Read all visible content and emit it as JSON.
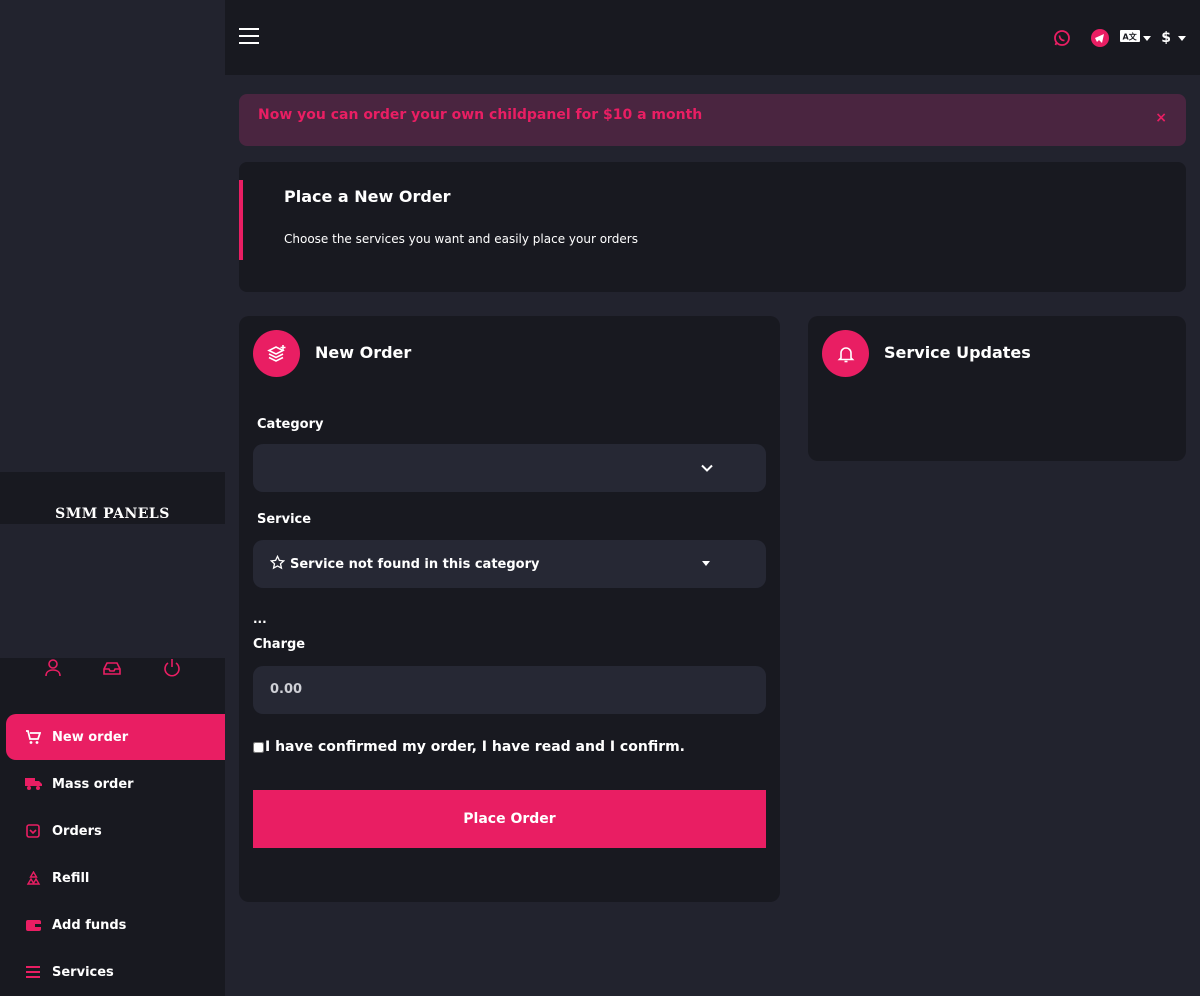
{
  "brand": {
    "logo_text": "SMM PANELS",
    "accent": "#e91e63"
  },
  "sidebar": {
    "user_icons": [
      "user-icon",
      "inbox-icon",
      "power-icon"
    ],
    "items": [
      {
        "label": "New order",
        "icon": "cart-plus-icon",
        "active": true
      },
      {
        "label": "Mass order",
        "icon": "truck-icon",
        "active": false
      },
      {
        "label": "Orders",
        "icon": "box-icon",
        "active": false
      },
      {
        "label": "Refill",
        "icon": "recycle-icon",
        "active": false
      },
      {
        "label": "Add funds",
        "icon": "wallet-icon",
        "active": false
      },
      {
        "label": "Services",
        "icon": "list-icon",
        "active": false
      }
    ]
  },
  "topbar": {
    "icons": [
      "whatsapp-icon",
      "telegram-icon",
      "language-icon"
    ],
    "currency": "$"
  },
  "alert": {
    "text": "Now you can order your own childpanel for $10 a month",
    "close": "×"
  },
  "hero": {
    "title": "Place a New Order",
    "description": "Choose the services you want and easily place your orders"
  },
  "order_form": {
    "title": "New Order",
    "category_label": "Category",
    "category_value": "",
    "service_label": "Service",
    "service_value": "Service not found in this category",
    "description_placeholder": "...",
    "charge_label": "Charge",
    "charge_value": "0.00",
    "confirm_text": "I have confirmed my order, I have read and I confirm.",
    "submit_label": "Place Order"
  },
  "updates": {
    "title": "Service Updates"
  }
}
